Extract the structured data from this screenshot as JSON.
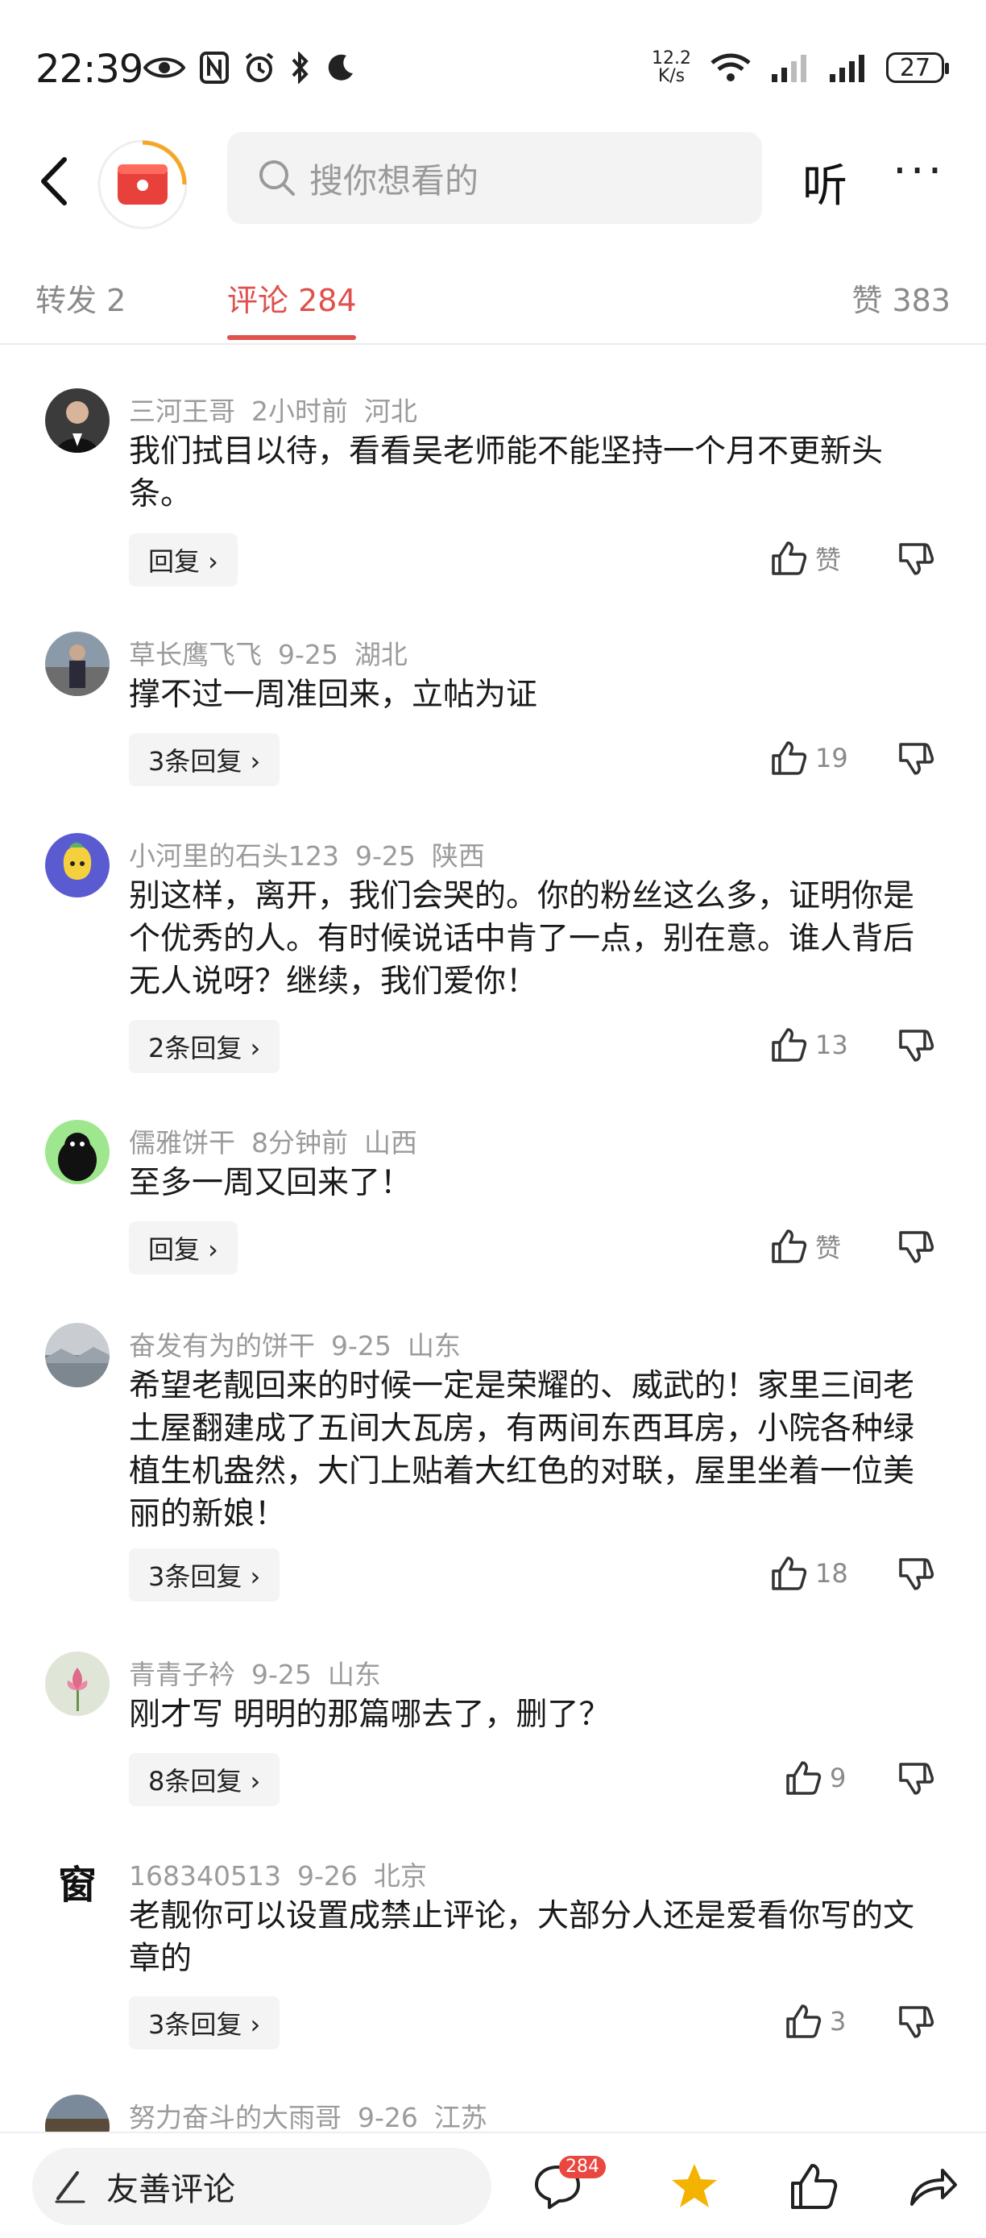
{
  "status_bar": {
    "time": "22:39",
    "net_speed_value": "12.2",
    "net_speed_unit": "K/s",
    "battery": "27"
  },
  "nav": {
    "search_placeholder": "搜你想看的",
    "listen_label": "听",
    "more_label": "···"
  },
  "tabs": {
    "repost": "转发 2",
    "comments": "评论 284",
    "likes": "赞 383"
  },
  "comments": [
    {
      "user": "三河王哥",
      "time": "2小时前",
      "location": "河北",
      "text": "我们拭目以待，看看吴老师能不能坚持一个月不更新头条。",
      "reply_label": "回复 ›",
      "likes": "赞"
    },
    {
      "user": "草长鹰飞飞",
      "time": "9-25",
      "location": "湖北",
      "text": "撑不过一周准回来，立帖为证",
      "reply_label": "3条回复 ›",
      "likes": "19"
    },
    {
      "user": "小河里的石头123",
      "time": "9-25",
      "location": "陕西",
      "text": "别这样，离开，我们会哭的。你的粉丝这么多，证明你是个优秀的人。有时候说话中肯了一点，别在意。谁人背后无人说呀？继续，我们爱你！",
      "reply_label": "2条回复 ›",
      "likes": "13"
    },
    {
      "user": "儒雅饼干",
      "time": "8分钟前",
      "location": "山西",
      "text": "至多一周又回来了！",
      "reply_label": "回复 ›",
      "likes": "赞"
    },
    {
      "user": "奋发有为的饼干",
      "time": "9-25",
      "location": "山东",
      "text": "希望老靓回来的时候一定是荣耀的、威武的！家里三间老土屋翻建成了五间大瓦房，有两间东西耳房，小院各种绿植生机盎然，大门上贴着大红色的对联，屋里坐着一位美丽的新娘！",
      "reply_label": "3条回复 ›",
      "likes": "18"
    },
    {
      "user": "青青子衿",
      "time": "9-25",
      "location": "山东",
      "text": "刚才写 明明的那篇哪去了，删了？",
      "reply_label": "8条回复 ›",
      "likes": "9"
    },
    {
      "user": "168340513",
      "time": "9-26",
      "location": "北京",
      "text": "老靓你可以设置成禁止评论，大部分人还是爱看你写的文章的",
      "reply_label": "3条回复 ›",
      "likes": "3"
    },
    {
      "user": "努力奋斗的大雨哥",
      "time": "9-26",
      "location": "江苏",
      "text": "",
      "reply_label": "",
      "likes": ""
    }
  ],
  "avatar_glyph_7": "窗",
  "bottom_bar": {
    "input_placeholder": "友善评论",
    "comment_badge": "284"
  },
  "colors": {
    "accent": "#e0504c",
    "star": "#f5b301"
  }
}
